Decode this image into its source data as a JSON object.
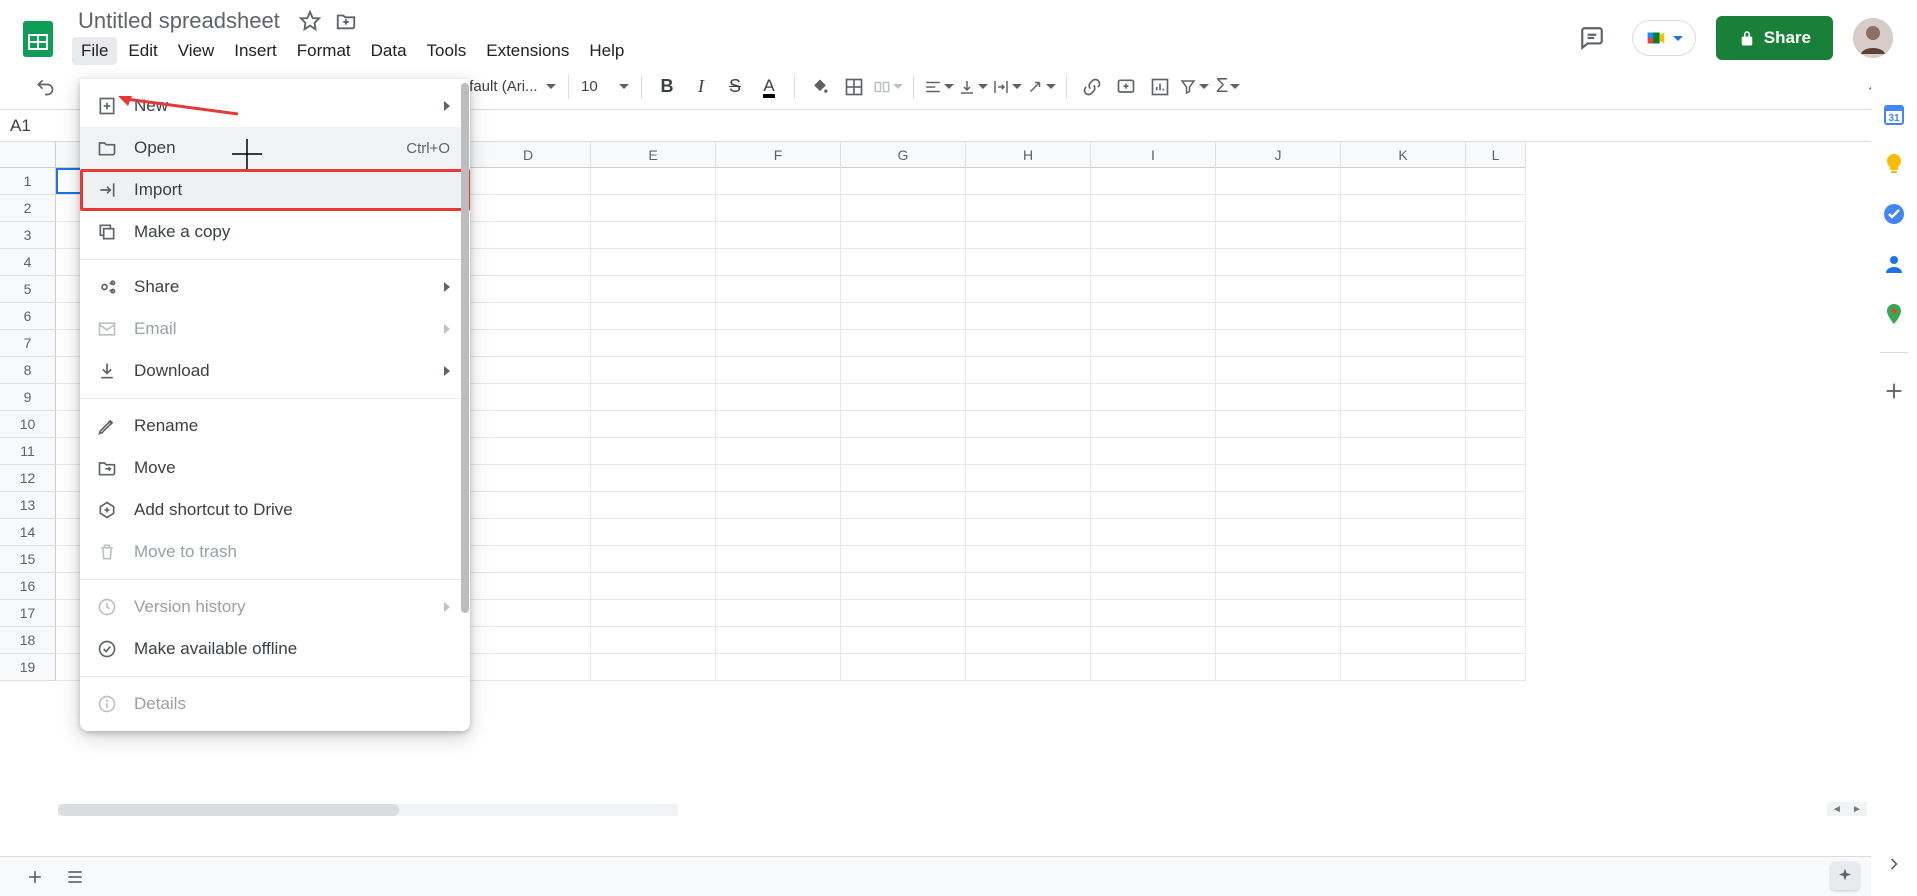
{
  "doc_title": "Untitled spreadsheet",
  "menubar": [
    "File",
    "Edit",
    "View",
    "Insert",
    "Format",
    "Data",
    "Tools",
    "Extensions",
    "Help"
  ],
  "share_label": "Share",
  "toolbar": {
    "font": "Default (Ari...",
    "size": "10"
  },
  "name_box": "A1",
  "columns": [
    "D",
    "E",
    "F",
    "G",
    "H",
    "I",
    "J",
    "K",
    "L"
  ],
  "first_visible_row": 1,
  "visible_row_count": 19,
  "file_menu": {
    "new": "New",
    "open": "Open",
    "open_shortcut": "Ctrl+O",
    "import": "Import",
    "make_copy": "Make a copy",
    "share": "Share",
    "email": "Email",
    "download": "Download",
    "rename": "Rename",
    "move": "Move",
    "add_shortcut": "Add shortcut to Drive",
    "move_trash": "Move to trash",
    "version_history": "Version history",
    "available_offline": "Make available offline",
    "details": "Details"
  },
  "side_panel": {
    "calendar_day": "31"
  }
}
